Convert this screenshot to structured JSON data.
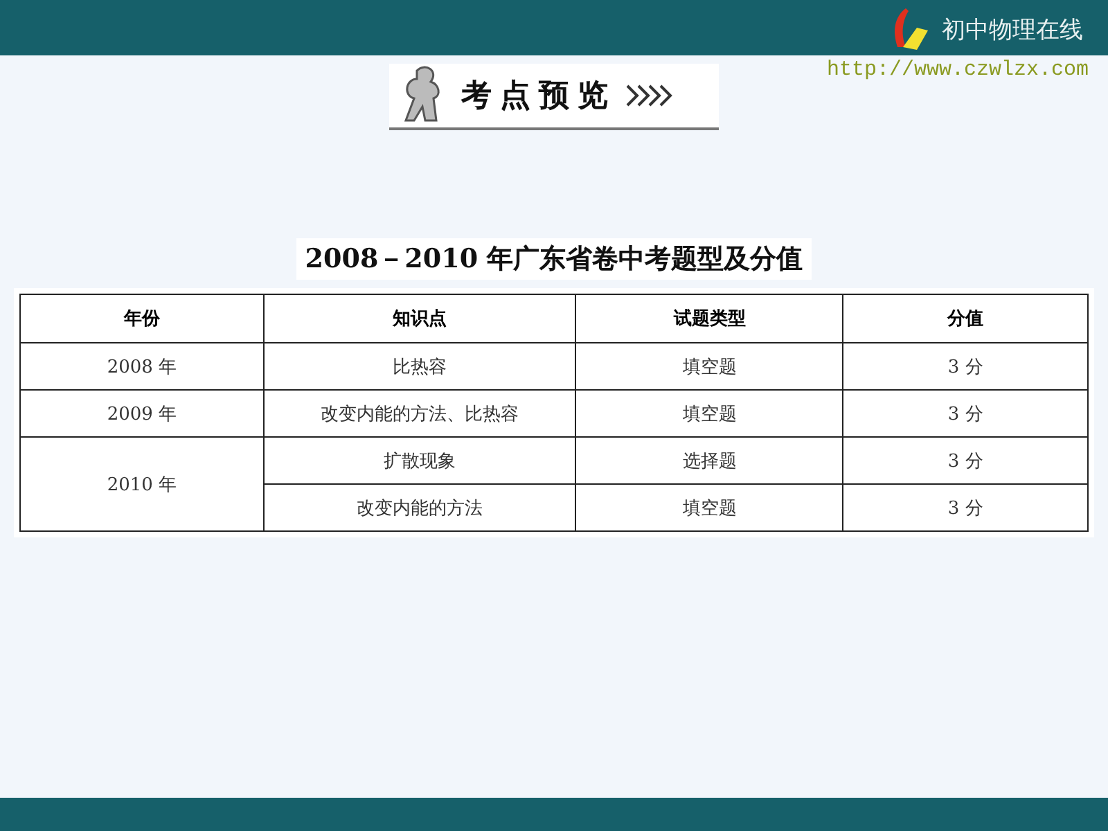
{
  "site": {
    "name": "初中物理在线",
    "url": "http://www.czwlzx.com"
  },
  "banner": {
    "title": "考点预览"
  },
  "table_title": "2008－2010 年广东省卷中考题型及分值",
  "table": {
    "columns": [
      "年份",
      "知识点",
      "试题类型",
      "分值"
    ],
    "groups": [
      {
        "year": "2008 年",
        "items": [
          {
            "topic": "比热容",
            "type": "填空题",
            "score": "3 分"
          }
        ]
      },
      {
        "year": "2009 年",
        "items": [
          {
            "topic": "改变内能的方法、比热容",
            "type": "填空题",
            "score": "3 分"
          }
        ]
      },
      {
        "year": "2010 年",
        "items": [
          {
            "topic": "扩散现象",
            "type": "选择题",
            "score": "3 分"
          },
          {
            "topic": "改变内能的方法",
            "type": "填空题",
            "score": "3 分"
          }
        ]
      }
    ]
  }
}
